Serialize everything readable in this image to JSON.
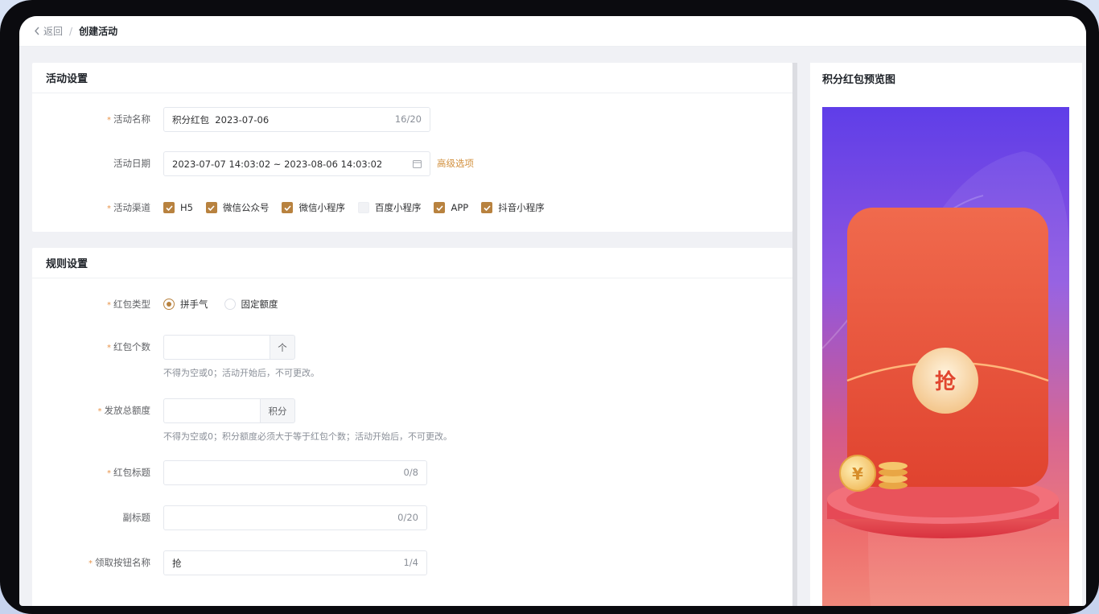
{
  "breadcrumb": {
    "back": "返回",
    "separator": "/",
    "current": "创建活动"
  },
  "activity_settings": {
    "title": "活动设置",
    "name": {
      "label": "活动名称",
      "value": "积分红包  2023-07-06",
      "counter": "16/20"
    },
    "date": {
      "label": "活动日期",
      "value": "2023-07-07 14:03:02 ~ 2023-08-06 14:03:02",
      "advanced_link": "高级选项"
    },
    "channels": {
      "label": "活动渠道",
      "items": [
        {
          "label": "H5",
          "checked": true
        },
        {
          "label": "微信公众号",
          "checked": true
        },
        {
          "label": "微信小程序",
          "checked": true
        },
        {
          "label": "百度小程序",
          "checked": false
        },
        {
          "label": "APP",
          "checked": true
        },
        {
          "label": "抖音小程序",
          "checked": true
        }
      ]
    }
  },
  "rule_settings": {
    "title": "规则设置",
    "type": {
      "label": "红包类型",
      "options": [
        "拼手气",
        "固定额度"
      ],
      "selected": "拼手气"
    },
    "count": {
      "label": "红包个数",
      "value": "",
      "unit": "个",
      "hint": "不得为空或0；活动开始后，不可更改。"
    },
    "total": {
      "label": "发放总额度",
      "value": "",
      "unit": "积分",
      "hint": "不得为空或0；积分额度必须大于等于红包个数；活动开始后，不可更改。"
    },
    "title_field": {
      "label": "红包标题",
      "value": "",
      "counter": "0/8"
    },
    "subtitle": {
      "label": "副标题",
      "value": "",
      "counter": "0/20"
    },
    "button_name": {
      "label": "领取按钮名称",
      "value": "抢",
      "counter": "1/4"
    }
  },
  "preview": {
    "title": "积分红包预览图",
    "button_char": "抢",
    "coin_symbol": "¥"
  },
  "colors": {
    "accent": "#b8823f",
    "required_mark": "#e8944a",
    "link": "#d2903e",
    "envelope": "#e8573d"
  }
}
